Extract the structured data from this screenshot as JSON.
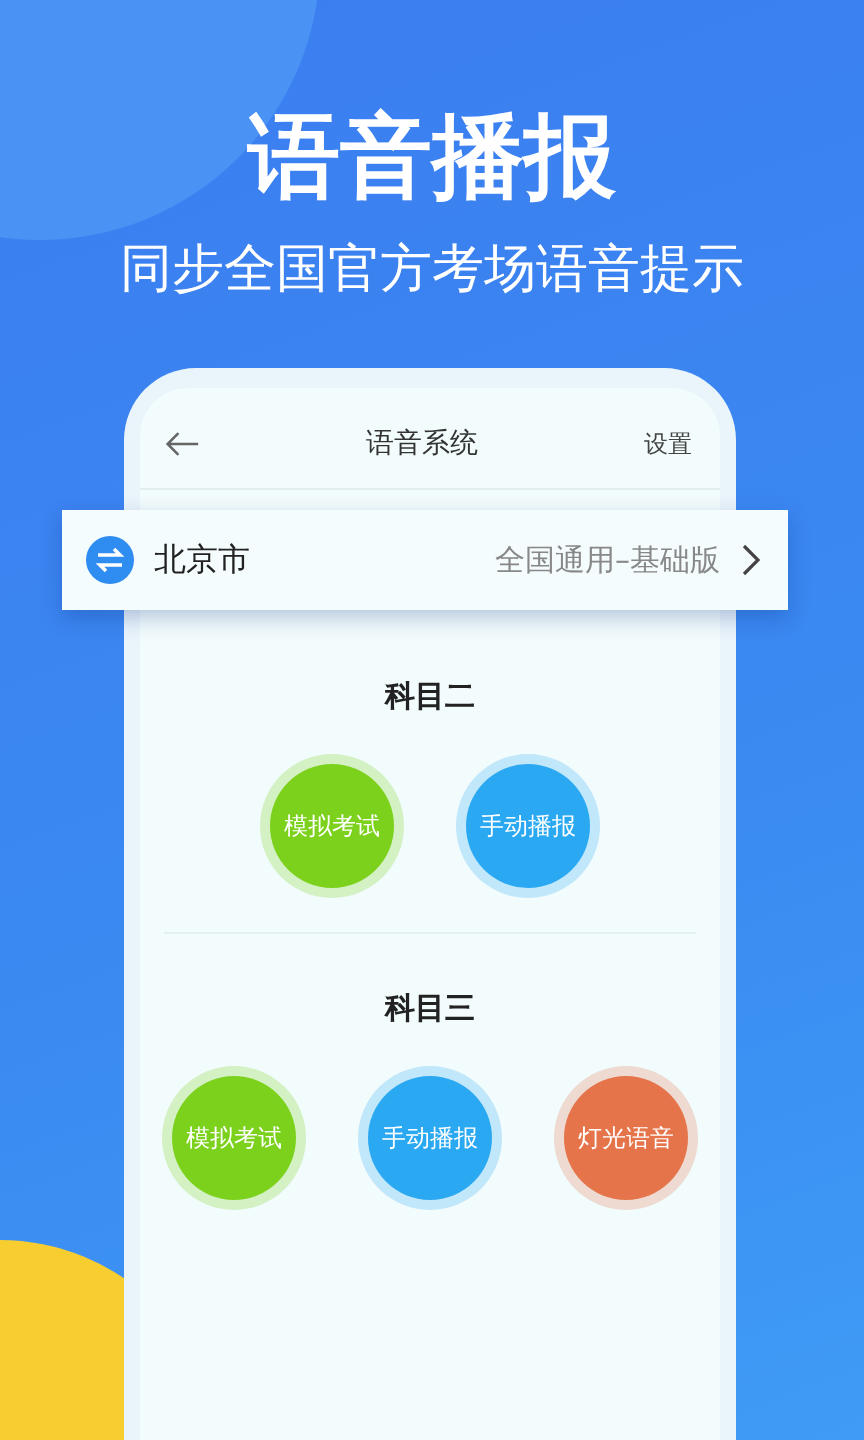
{
  "headline": "语音播报",
  "subtitle": "同步全国官方考场语音提示",
  "phone": {
    "nav": {
      "title": "语音系统",
      "action": "设置"
    },
    "city_bar": {
      "city": "北京市",
      "version": "全国通用–基础版"
    },
    "sections": [
      {
        "title": "科目二",
        "buttons": [
          {
            "label": "模拟考试",
            "color": "#7cd11c"
          },
          {
            "label": "手动播报",
            "color": "#2aa8f2"
          }
        ]
      },
      {
        "title": "科目三",
        "buttons": [
          {
            "label": "模拟考试",
            "color": "#7cd11c"
          },
          {
            "label": "手动播报",
            "color": "#2aa8f2"
          },
          {
            "label": "灯光语音",
            "color": "#e5744a"
          }
        ]
      }
    ]
  }
}
